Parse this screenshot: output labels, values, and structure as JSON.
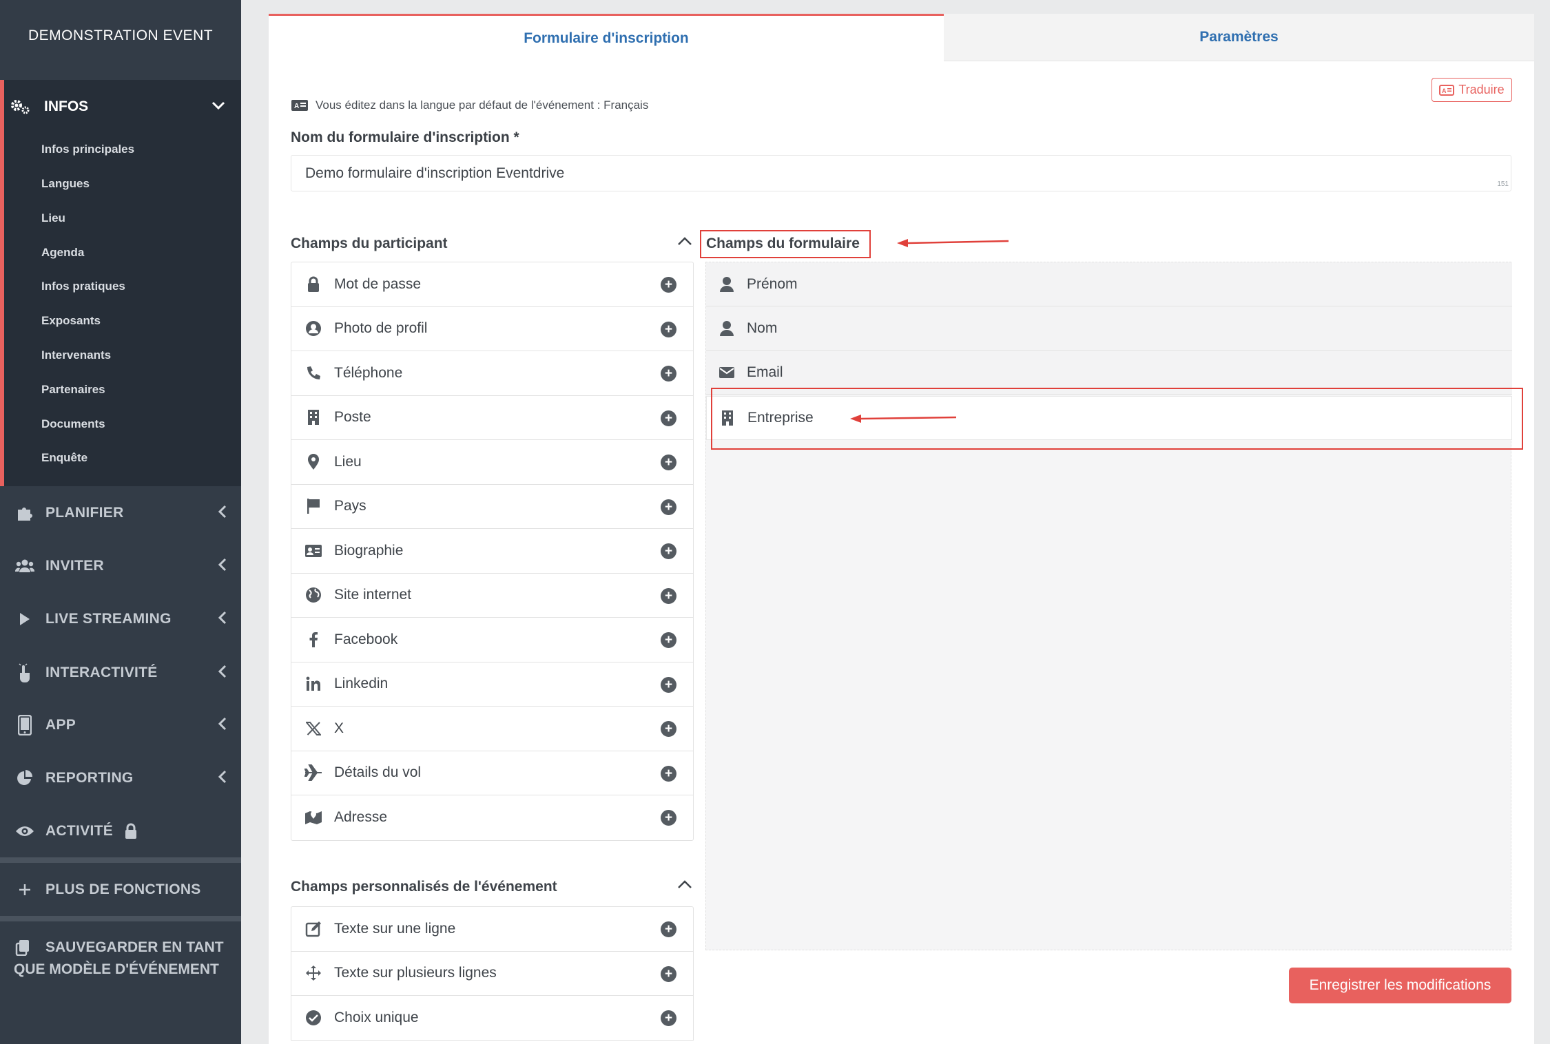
{
  "sidebar": {
    "event_title": "DEMONSTRATION EVENT",
    "infos": {
      "label": "INFOS",
      "items": [
        "Infos principales",
        "Langues",
        "Lieu",
        "Agenda",
        "Infos pratiques",
        "Exposants",
        "Intervenants",
        "Partenaires",
        "Documents",
        "Enquête"
      ]
    },
    "sections": [
      {
        "label": "PLANIFIER",
        "icon": "puzzle-icon"
      },
      {
        "label": "INVITER",
        "icon": "users-icon"
      },
      {
        "label": "LIVE STREAMING",
        "icon": "play-icon"
      },
      {
        "label": "INTERACTIVITÉ",
        "icon": "pointer-hand-icon"
      },
      {
        "label": "APP",
        "icon": "mobile-icon"
      },
      {
        "label": "REPORTING",
        "icon": "pie-chart-icon"
      },
      {
        "label": "ACTIVITÉ",
        "icon": "eye-icon"
      }
    ],
    "more_functions": "PLUS DE FONCTIONS",
    "save_template_line1": "SAUVEGARDER EN TANT",
    "save_template_line2": "QUE MODÈLE D'ÉVÉNEMENT"
  },
  "tabs": {
    "active": "Formulaire d'inscription",
    "inactive": "Paramètres"
  },
  "lang_note": "Vous éditez dans la langue par défaut de l'événement : Français",
  "translate_button": "Traduire",
  "form_name": {
    "label": "Nom du formulaire d'inscription *",
    "value": "Demo formulaire d'inscription Eventdrive",
    "char_count": "151"
  },
  "participant_fields": {
    "title": "Champs du participant",
    "items": [
      {
        "label": "Mot de passe",
        "icon": "lock-icon"
      },
      {
        "label": "Photo de profil",
        "icon": "user-circle-icon"
      },
      {
        "label": "Téléphone",
        "icon": "phone-icon"
      },
      {
        "label": "Poste",
        "icon": "building-icon"
      },
      {
        "label": "Lieu",
        "icon": "map-pin-icon"
      },
      {
        "label": "Pays",
        "icon": "flag-icon"
      },
      {
        "label": "Biographie",
        "icon": "id-card-icon"
      },
      {
        "label": "Site internet",
        "icon": "globe-icon"
      },
      {
        "label": "Facebook",
        "icon": "facebook-icon"
      },
      {
        "label": "Linkedin",
        "icon": "linkedin-icon"
      },
      {
        "label": "X",
        "icon": "x-icon"
      },
      {
        "label": "Détails du vol",
        "icon": "plane-icon"
      },
      {
        "label": "Adresse",
        "icon": "map-icon"
      }
    ]
  },
  "custom_fields": {
    "title": "Champs personnalisés de l'événement",
    "items": [
      {
        "label": "Texte sur une ligne",
        "icon": "edit-icon"
      },
      {
        "label": "Texte sur plusieurs lignes",
        "icon": "move-icon"
      },
      {
        "label": "Choix unique",
        "icon": "check-circle-icon"
      }
    ]
  },
  "form_fields": {
    "title": "Champs du formulaire",
    "items": [
      {
        "label": "Prénom",
        "icon": "user-icon"
      },
      {
        "label": "Nom",
        "icon": "user-icon"
      },
      {
        "label": "Email",
        "icon": "envelope-icon"
      },
      {
        "label": "Entreprise",
        "icon": "building-icon"
      }
    ]
  },
  "save_button": "Enregistrer les modifications",
  "colors": {
    "accent": "#e8615e",
    "link_blue": "#2f6fb0",
    "sidebar_bg": "#333c47",
    "annotation_red": "#e0403a"
  }
}
